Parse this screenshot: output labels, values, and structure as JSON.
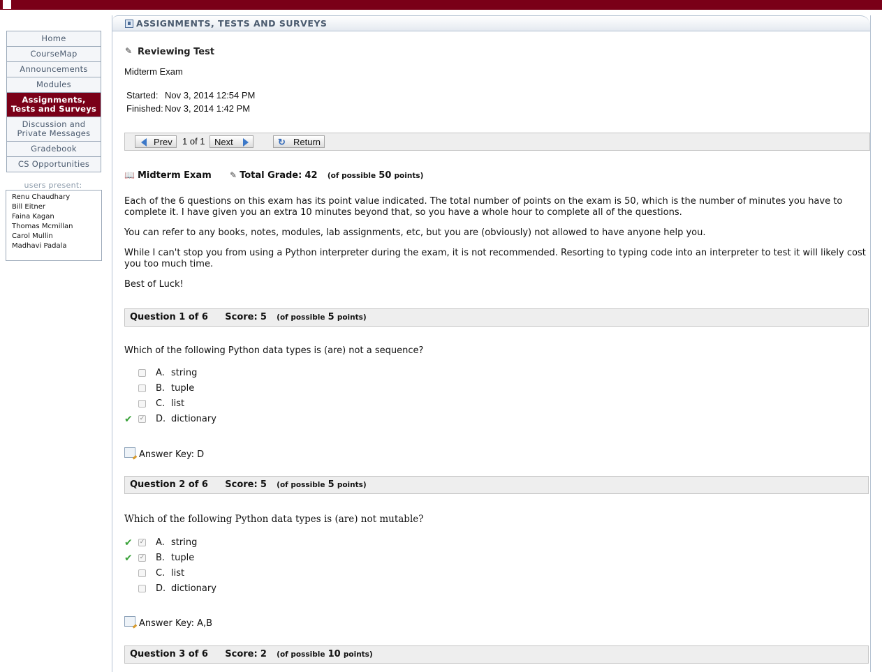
{
  "topbar": {
    "label": ""
  },
  "nav": {
    "items": [
      {
        "label": "Home",
        "active": false
      },
      {
        "label": "CourseMap",
        "active": false
      },
      {
        "label": "Announcements",
        "active": false
      },
      {
        "label": "Modules",
        "active": false
      },
      {
        "label": "Assignments, Tests and Surveys",
        "active": true
      },
      {
        "label": "Discussion and Private Messages",
        "active": false
      },
      {
        "label": "Gradebook",
        "active": false
      },
      {
        "label": "CS Opportunities",
        "active": false
      }
    ]
  },
  "users": {
    "title": "users present:",
    "list": [
      "Renu Chaudhary",
      "Bill Eitner",
      "Faina Kagan",
      "Thomas Mcmillan",
      "Carol Mullin",
      "Madhavi Padala"
    ]
  },
  "panel": {
    "title": "ASSIGNMENTS, TESTS AND SURVEYS"
  },
  "review": {
    "heading": "Reviewing Test",
    "exam_name": "Midterm Exam",
    "started_label": "Started:",
    "started_value": "Nov 3, 2014 12:54 PM",
    "finished_label": "Finished:",
    "finished_value": "Nov 3, 2014 1:42 PM"
  },
  "pager": {
    "prev_label": "Prev",
    "page_indicator": "1 of 1",
    "next_label": "Next",
    "return_label": "Return"
  },
  "grade": {
    "exam_title": "Midterm Exam",
    "total_label": "Total Grade:",
    "total_value": "42",
    "possible_prefix": "(of possible",
    "possible_value": "50",
    "possible_suffix": "points)"
  },
  "intro": [
    "Each of the 6 questions on this exam has its point value indicated. The total number of points on the exam is 50, which is the number of minutes you have to complete it. I have given you an extra 10 minutes beyond that, so you have a whole hour to complete all of the questions.",
    "You can refer to any books, notes, modules, lab assignments, etc, but you are (obviously) not allowed to have anyone help you.",
    "While I can't stop you from using a Python interpreter during the exam, it is not recommended. Resorting to typing code into an interpreter to test it will likely cost you too much time.",
    "Best of Luck!"
  ],
  "questions": [
    {
      "header": "Question 1 of 6",
      "score_label": "Score:",
      "score": "5",
      "possible_prefix": "(of possible",
      "possible": "5",
      "possible_suffix": "points)",
      "text": "Which of the following Python data types is (are) not a sequence?",
      "options": [
        {
          "letter": "A.",
          "text": "string",
          "selected": false
        },
        {
          "letter": "B.",
          "text": "tuple",
          "selected": false
        },
        {
          "letter": "C.",
          "text": "list",
          "selected": false
        },
        {
          "letter": "D.",
          "text": "dictionary",
          "selected": true
        }
      ],
      "answer_key": "Answer Key: D"
    },
    {
      "header": "Question 2 of 6",
      "score_label": "Score:",
      "score": "5",
      "possible_prefix": "(of possible",
      "possible": "5",
      "possible_suffix": "points)",
      "text": "Which of the following Python data types is (are) not mutable?",
      "options": [
        {
          "letter": "A.",
          "text": "string",
          "selected": true
        },
        {
          "letter": "B.",
          "text": "tuple",
          "selected": true
        },
        {
          "letter": "C.",
          "text": "list",
          "selected": false
        },
        {
          "letter": "D.",
          "text": "dictionary",
          "selected": false
        }
      ],
      "answer_key": "Answer Key: A,B"
    },
    {
      "header": "Question 3 of 6",
      "score_label": "Score:",
      "score": "2",
      "possible_prefix": "(of possible",
      "possible": "10",
      "possible_suffix": "points)"
    }
  ],
  "colors": {
    "brand": "#7a0018",
    "check": "#3aa23a",
    "arrow": "#3c78c8"
  }
}
